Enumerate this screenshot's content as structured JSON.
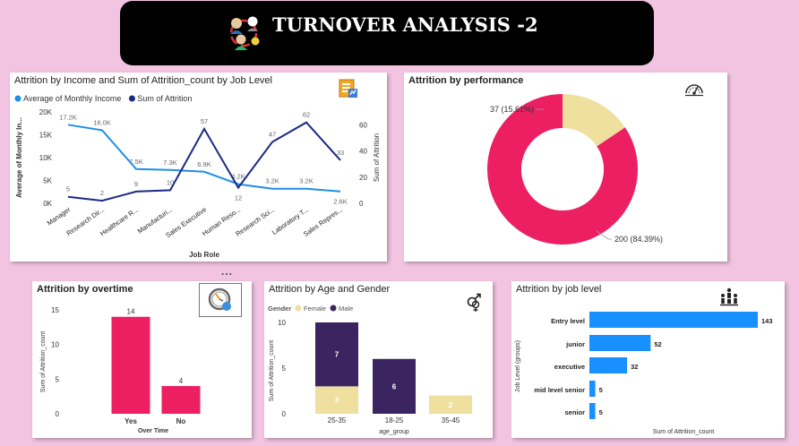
{
  "header": {
    "title": "TURNOVER ANALYSIS -2",
    "logo_icon": "people-network-icon"
  },
  "more_options_glyph": "...",
  "colors": {
    "page_bg": "#f2c4e1",
    "light_blue": "#1e8fe6",
    "navy": "#1b2a85",
    "pink": "#ed1f63",
    "cream": "#efe0a0",
    "purple": "#3b2560",
    "bar_blue": "#1890ff"
  },
  "chart_data": [
    {
      "id": "income_attrition",
      "type": "line",
      "title": "Attrition by Income and Sum of Attrition_count by Job Level",
      "xlabel": "Job Role",
      "ylabel": "Average of Monthly In...",
      "y2label": "Sum of Attrition",
      "categories": [
        "Manager",
        "Research Dir...",
        "Healthcare R...",
        "Manufacturi...",
        "Sales Executive",
        "Human Reso...",
        "Research Sci...",
        "Laboratory T...",
        "Sales Repres..."
      ],
      "series": [
        {
          "name": "Average of Monthly Income",
          "axis": "left",
          "values": [
            17200,
            16000,
            7500,
            7300,
            6900,
            4200,
            3200,
            3200,
            2600
          ],
          "labels": [
            "17.2K",
            "16.0K",
            "7.5K",
            "7.3K",
            "6.9K",
            "4.2K",
            "3.2K",
            "3.2K",
            "2.6K"
          ]
        },
        {
          "name": "Sum of Attrition",
          "axis": "right",
          "values": [
            5,
            2,
            9,
            10,
            57,
            12,
            47,
            62,
            33
          ],
          "labels": [
            "5",
            "2",
            "9",
            "10",
            "57",
            "12",
            "47",
            "62",
            "33"
          ]
        }
      ],
      "ylim": [
        0,
        20000
      ],
      "yticks": [
        "0K",
        "5K",
        "10K",
        "15K",
        "20K"
      ],
      "y2lim": [
        0,
        70
      ],
      "y2ticks": [
        "0",
        "20",
        "40",
        "60"
      ],
      "icon": "report-icon"
    },
    {
      "id": "performance",
      "type": "pie",
      "title": "Attrition by performance",
      "slices": [
        {
          "value": 200,
          "label": "200 (84.39%)"
        },
        {
          "value": 37,
          "label": "37 (15.61%)"
        }
      ],
      "icon": "gauge-icon"
    },
    {
      "id": "overtime",
      "type": "bar",
      "title": "Attrition  by overtime",
      "xlabel": "Over Time",
      "ylabel": "Sum of Attrition_count",
      "categories": [
        "Yes",
        "No"
      ],
      "values": [
        14,
        4
      ],
      "ylim": [
        0,
        15
      ],
      "yticks": [
        "0",
        "5",
        "10",
        "15"
      ],
      "icon": "clock-icon"
    },
    {
      "id": "age_gender",
      "type": "bar",
      "title": "Attrition by Age and Gender",
      "xlabel": "age_group",
      "ylabel": "Sum of Attrition_count",
      "legend_title": "Gender",
      "categories": [
        "25-35",
        "18-25",
        "35-45"
      ],
      "series": [
        {
          "name": "Female",
          "values": [
            3,
            0,
            2
          ],
          "labels": [
            "3",
            "",
            "2"
          ]
        },
        {
          "name": "Male",
          "values": [
            7,
            6,
            0
          ],
          "labels": [
            "7",
            "6",
            ""
          ]
        }
      ],
      "ylim": [
        0,
        10
      ],
      "yticks": [
        "0",
        "5",
        "10"
      ],
      "icon": "gender-icon"
    },
    {
      "id": "job_level",
      "type": "bar",
      "title": "Attrition by job level",
      "xlabel": "Sum of Attrition_count",
      "ylabel": "Job Level (groups)",
      "categories": [
        "Entry level",
        "junior",
        "executive",
        "mid level senior",
        "senior"
      ],
      "values": [
        143,
        52,
        32,
        5,
        5
      ],
      "icon": "org-chart-icon"
    }
  ]
}
